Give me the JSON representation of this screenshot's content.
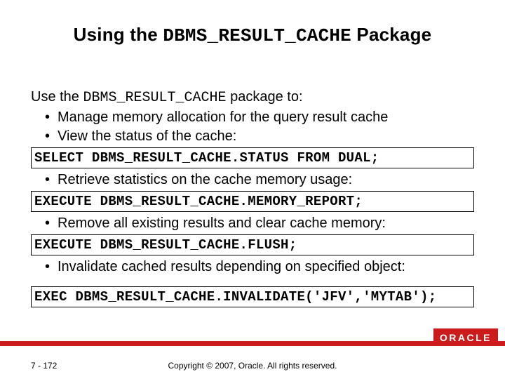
{
  "title": {
    "pre": "Using the ",
    "code": "DBMS_RESULT_CACHE",
    "post": " Package"
  },
  "intro": {
    "pre": "Use the ",
    "code": "DBMS_RESULT_CACHE",
    "post": " package to:"
  },
  "bullets": {
    "b1": "Manage memory allocation for the query result cache",
    "b2": "View the status of the cache:",
    "b3": "Retrieve statistics on the cache memory usage:",
    "b4": "Remove all existing results and clear cache memory:",
    "b5": "Invalidate cached results depending on specified object:"
  },
  "code": {
    "c1": "SELECT DBMS_RESULT_CACHE.STATUS FROM DUAL;",
    "c2": "EXECUTE DBMS_RESULT_CACHE.MEMORY_REPORT;",
    "c3": "EXECUTE DBMS_RESULT_CACHE.FLUSH;",
    "c4": "EXEC DBMS_RESULT_CACHE.INVALIDATE('JFV','MYTAB');"
  },
  "footer": {
    "brand": "ORACLE",
    "page": "7 - 172",
    "copyright": "Copyright © 2007, Oracle. All rights reserved."
  }
}
